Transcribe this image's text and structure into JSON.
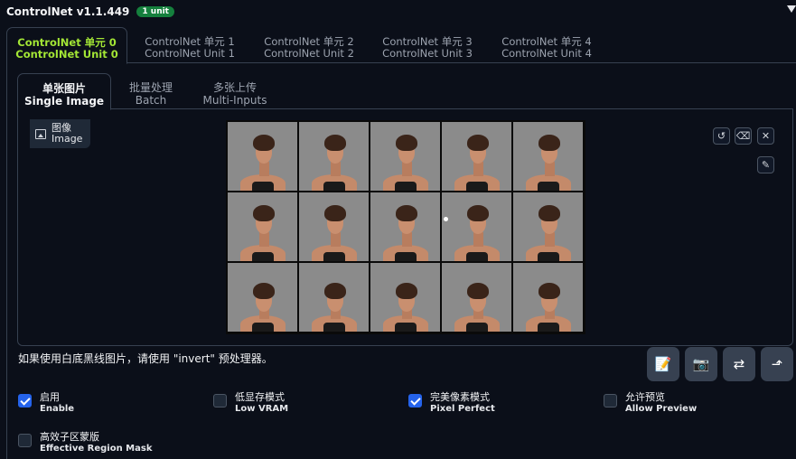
{
  "header": {
    "title": "ControlNet v1.1.449",
    "badge": "1 unit"
  },
  "unit_tabs": [
    {
      "zh": "ControlNet 单元 0",
      "en": "ControlNet Unit 0",
      "active": true
    },
    {
      "zh": "ControlNet 单元 1",
      "en": "ControlNet Unit 1",
      "active": false
    },
    {
      "zh": "ControlNet 单元 2",
      "en": "ControlNet Unit 2",
      "active": false
    },
    {
      "zh": "ControlNet 单元 3",
      "en": "ControlNet Unit 3",
      "active": false
    },
    {
      "zh": "ControlNet 单元 4",
      "en": "ControlNet Unit 4",
      "active": false
    }
  ],
  "mode_tabs": [
    {
      "zh": "单张图片",
      "en": "Single Image",
      "active": true
    },
    {
      "zh": "批量处理",
      "en": "Batch",
      "active": false
    },
    {
      "zh": "多张上传",
      "en": "Multi-Inputs",
      "active": false
    }
  ],
  "image_label": {
    "zh": "图像",
    "en": "Image",
    "icon": "image-icon"
  },
  "image_tools": {
    "undo_icon": "↺",
    "clear_icon": "⌫",
    "close_icon": "✕",
    "brush_icon": "✎"
  },
  "hint": "如果使用白底黑线图片，请使用 \"invert\" 预处理器。",
  "action_buttons": [
    {
      "icon": "📝",
      "name": "edit-notes-button"
    },
    {
      "icon": "📷",
      "name": "camera-button"
    },
    {
      "icon": "⇄",
      "name": "swap-button"
    },
    {
      "icon": "⬏",
      "name": "send-dimensions-button"
    }
  ],
  "options": [
    {
      "zh": "启用",
      "en": "Enable",
      "checked": true
    },
    {
      "zh": "低显存模式",
      "en": "Low VRAM",
      "checked": false
    },
    {
      "zh": "完美像素模式",
      "en": "Pixel Perfect",
      "checked": true
    },
    {
      "zh": "允许预览",
      "en": "Allow Preview",
      "checked": false
    },
    {
      "zh": "高效子区蒙版",
      "en": "Effective Region Mask",
      "checked": false
    }
  ],
  "colors": {
    "background": "#0b0f19",
    "active_tab": "#a3e635",
    "badge": "#15803d",
    "checkbox_checked": "#2563eb"
  }
}
